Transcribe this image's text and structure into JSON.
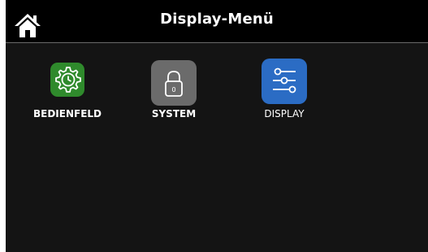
{
  "header": {
    "title": "Display-Menü",
    "home_icon": "home-icon"
  },
  "tiles": [
    {
      "label": "BEDIENFELD",
      "icon": "gear-clock-icon",
      "color": "#2f8a2c"
    },
    {
      "label": "SYSTEM",
      "icon": "padlock-icon",
      "color": "#6b6b6b",
      "lock_text": "0"
    },
    {
      "label": "DISPLAY",
      "icon": "sliders-icon",
      "color": "#2b6cc4"
    }
  ],
  "colors": {
    "background": "#141414",
    "header": "#000000",
    "text": "#ffffff"
  }
}
